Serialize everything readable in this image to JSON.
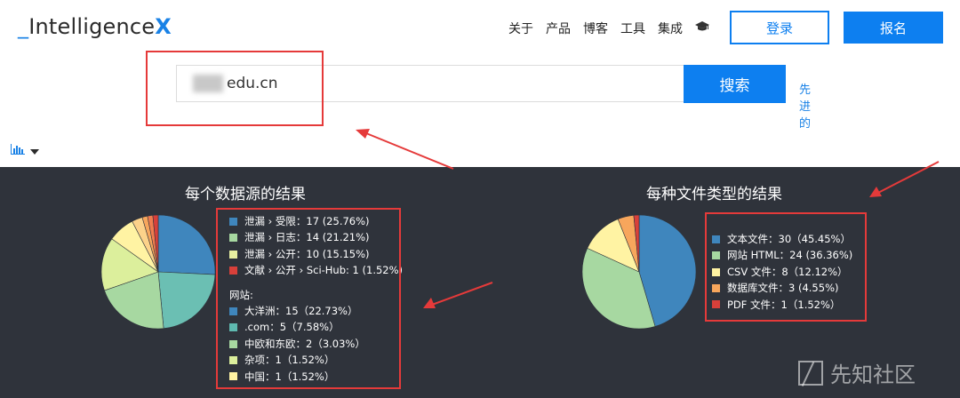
{
  "header": {
    "logo_underscore": "_",
    "logo_text": "Intelligence",
    "logo_x": "X",
    "nav": [
      "关于",
      "产品",
      "博客",
      "工具",
      "集成"
    ],
    "nav_icon": "graduation-cap-icon",
    "login_label": "登录",
    "signup_label": "报名"
  },
  "search": {
    "value": "edu.cn",
    "button_label": "搜索",
    "side_link": "先进的"
  },
  "toolbar": {
    "chart_icon": "bar-chart-icon",
    "dropdown_icon": "caret-down-icon"
  },
  "colors": {
    "accent": "#0d7ff0",
    "panel_bg": "#2f333b",
    "annotation_red": "#e53a3a"
  },
  "source_chart": {
    "title": "每个数据源的结果",
    "leaks": [
      {
        "label": "泄漏 › 受限：17 (25.76%)",
        "color": "#3f86bd"
      },
      {
        "label": "泄漏 › 日志：14 (21.21%)",
        "color": "#a7d8a1"
      },
      {
        "label": "泄漏 › 公开：10 (15.15%)",
        "color": "#e8f0a0"
      },
      {
        "label": "文献 › 公开 › Sci-Hub: 1 (1.52%)",
        "color": "#d8403a"
      }
    ],
    "websites_label": "网站:",
    "websites": [
      {
        "label": "大洋洲：15（22.73%）",
        "color": "#3f86bd"
      },
      {
        "label": ".com：5（7.58%）",
        "color": "#5fb9b0"
      },
      {
        "label": "中欧和东欧：2（3.03%）",
        "color": "#a7d8a1"
      },
      {
        "label": "杂项：1（1.52%）",
        "color": "#dcef9c"
      },
      {
        "label": "中国：1（1.52%）",
        "color": "#fff3a3"
      }
    ]
  },
  "filetype_chart": {
    "title": "每种文件类型的结果",
    "items": [
      {
        "label": "文本文件：30（45.45%）",
        "color": "#3f86bd"
      },
      {
        "label": "网站 HTML：24 (36.36%)",
        "color": "#a7d8a1"
      },
      {
        "label": "CSV 文件：8（12.12%）",
        "color": "#fff3a3"
      },
      {
        "label": "数据库文件：3 (4.55%)",
        "color": "#f7a65c"
      },
      {
        "label": "PDF 文件：1（1.52%）",
        "color": "#d8403a"
      }
    ]
  },
  "chart_data": [
    {
      "type": "pie",
      "title": "每个数据源的结果",
      "categories": [
        "泄漏 › 受限",
        "大洋洲",
        "泄漏 › 日志",
        "泄漏 › 公开",
        ".com",
        "中欧和东欧",
        "杂项",
        "中国",
        "文献 › 公开 › Sci-Hub"
      ],
      "values": [
        17,
        15,
        14,
        10,
        5,
        2,
        1,
        1,
        1
      ],
      "colors": [
        "#3f86bd",
        "#6bbfb3",
        "#a7d8a1",
        "#dcef9c",
        "#fff3a3",
        "#fcd28a",
        "#f7a65c",
        "#ef7d4f",
        "#d8403a"
      ]
    },
    {
      "type": "pie",
      "title": "每种文件类型的结果",
      "categories": [
        "文本文件",
        "网站 HTML",
        "CSV 文件",
        "数据库文件",
        "PDF 文件"
      ],
      "values": [
        30,
        24,
        8,
        3,
        1
      ],
      "colors": [
        "#3f86bd",
        "#a7d8a1",
        "#fff3a3",
        "#f7a65c",
        "#d8403a"
      ]
    }
  ],
  "watermark": "先知社区"
}
